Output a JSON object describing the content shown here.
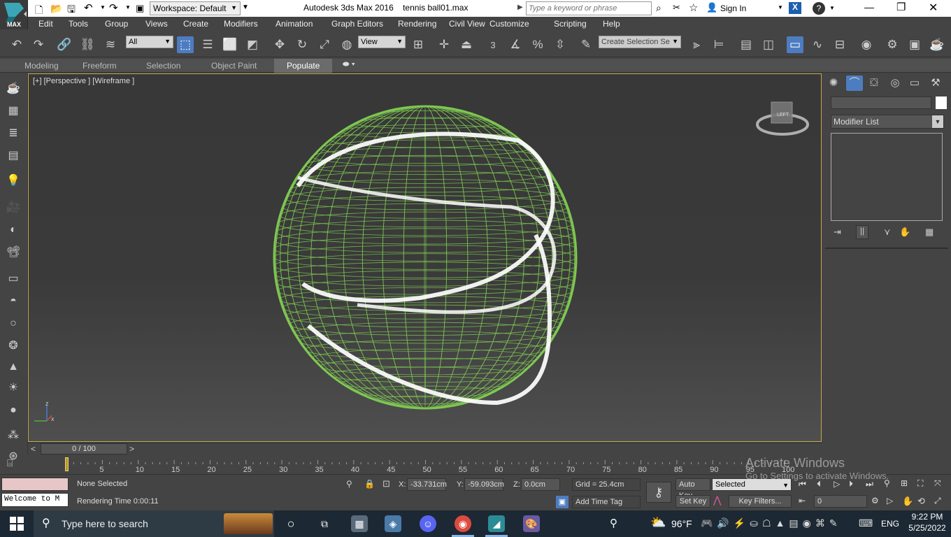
{
  "title_bar": {
    "workspace": "Workspace: Default",
    "app_title": "Autodesk 3ds Max 2016",
    "file_name": "tennis ball01.max",
    "search_placeholder": "Type a keyword or phrase",
    "sign_in": "Sign In",
    "logo_text": "MAX"
  },
  "menu": [
    "Edit",
    "Tools",
    "Group",
    "Views",
    "Create",
    "Modifiers",
    "Animation",
    "Graph Editors",
    "Rendering",
    "Civil View",
    "Customize",
    "Scripting",
    "Help"
  ],
  "toolbar": {
    "selection_filter": "All",
    "reference_coord": "View",
    "selection_set_placeholder": "Create Selection Se",
    "snap_label": "3"
  },
  "ribbon_tabs": [
    "Modeling",
    "Freeform",
    "Selection",
    "Object Paint",
    "Populate"
  ],
  "active_ribbon_tab": "Populate",
  "viewport": {
    "label": "[+] [Perspective ] [Wireframe ]",
    "viewcube_label": "LEFT",
    "axis_x": "x",
    "axis_z": "z",
    "wire_color": "#7ec850",
    "seam_color": "#ffffff",
    "border_color": "#c8a547"
  },
  "command_panel": {
    "name_value": "",
    "modifier_list": "Modifier List"
  },
  "time_slider": {
    "position": "0 / 100",
    "prev": "<",
    "next": ">"
  },
  "track_ticks": [
    "5",
    "10",
    "15",
    "20",
    "25",
    "30",
    "35",
    "40",
    "45",
    "50",
    "55",
    "60",
    "65",
    "70",
    "75",
    "80",
    "85",
    "90",
    "95",
    "100"
  ],
  "status": {
    "maxscript": "Welcome to M",
    "selection": "None Selected",
    "rendering_time": "Rendering Time  0:00:11",
    "x_label": "X:",
    "x_value": "-33.731cm",
    "y_label": "Y:",
    "y_value": "-59.093cm",
    "z_label": "Z:",
    "z_value": "0.0cm",
    "grid": "Grid = 25.4cm",
    "add_time_tag": "Add Time Tag",
    "auto_key": "Auto Key",
    "set_key": "Set Key",
    "key_mode": "Selected",
    "key_filters": "Key Filters...",
    "frame": "0"
  },
  "watermark": {
    "line1": "Activate Windows",
    "line2": "Go to Settings to activate Windows."
  },
  "taskbar": {
    "search_placeholder": "Type here to search",
    "weather": "96°F",
    "language": "ENG",
    "time": "9:22 PM",
    "date": "5/25/2022"
  }
}
